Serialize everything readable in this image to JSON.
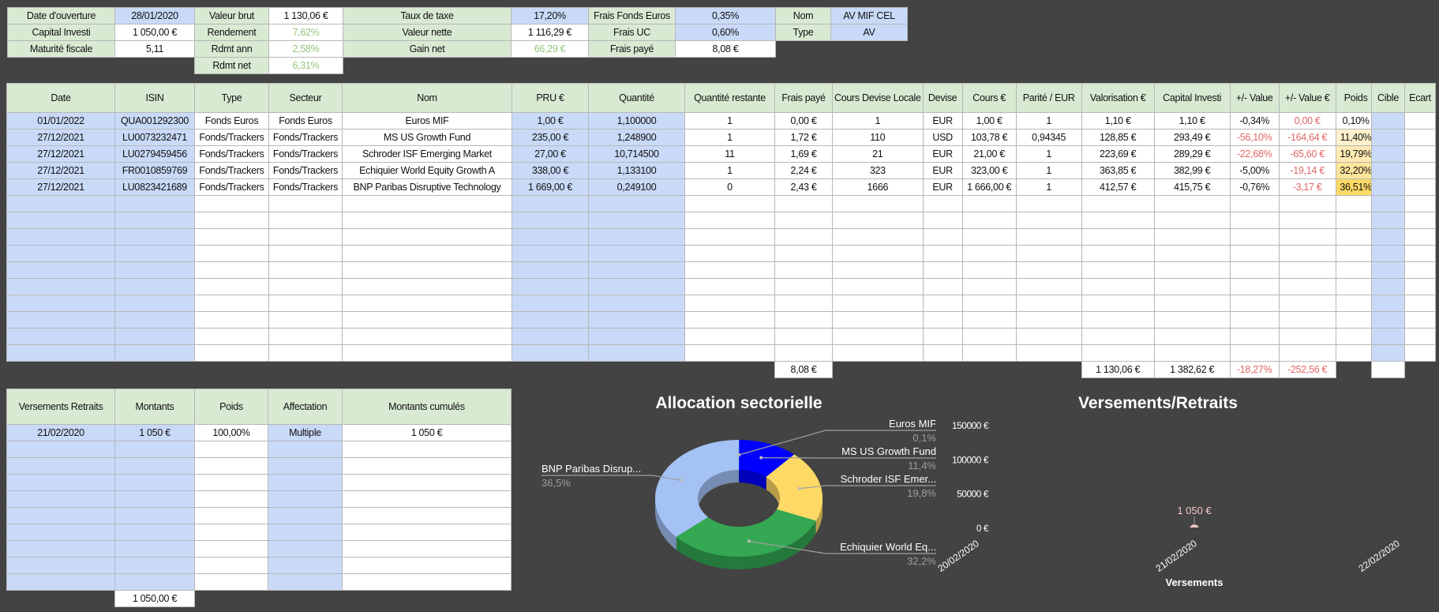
{
  "summary": {
    "rows": [
      [
        {
          "t": "Date d'ouverture",
          "s": "g"
        },
        {
          "t": "28/01/2020",
          "s": "b"
        },
        {
          "t": "Valeur brut",
          "s": "g"
        },
        {
          "t": "1 130,06 €",
          "s": "w"
        },
        {
          "t": "Taux de taxe",
          "s": "g"
        },
        {
          "t": "17,20%",
          "s": "b"
        },
        {
          "t": "Frais Fonds Euros",
          "s": "g"
        },
        {
          "t": "0,35%",
          "s": "b"
        },
        {
          "t": "Nom",
          "s": "g"
        },
        {
          "t": "AV MIF CEL",
          "s": "b"
        }
      ],
      [
        {
          "t": "Capital Investi",
          "s": "g"
        },
        {
          "t": "1 050,00 €",
          "s": "w"
        },
        {
          "t": "Rendement",
          "s": "g"
        },
        {
          "t": "7,62%",
          "s": "w",
          "tc": "green"
        },
        {
          "t": "Valeur nette",
          "s": "g"
        },
        {
          "t": "1 116,29 €",
          "s": "w"
        },
        {
          "t": "Frais UC",
          "s": "g"
        },
        {
          "t": "0,60%",
          "s": "b"
        },
        {
          "t": "Type",
          "s": "g"
        },
        {
          "t": "AV",
          "s": "b"
        }
      ],
      [
        {
          "t": "Maturité fiscale",
          "s": "g"
        },
        {
          "t": "5,11",
          "s": "w"
        },
        {
          "t": "Rdmt ann",
          "s": "g"
        },
        {
          "t": "2,58%",
          "s": "w",
          "tc": "green"
        },
        {
          "t": "Gain net",
          "s": "g"
        },
        {
          "t": "66,29 €",
          "s": "w",
          "tc": "green"
        },
        {
          "t": "Frais payé",
          "s": "g"
        },
        {
          "t": "8,08 €",
          "s": "w"
        },
        {
          "t": "",
          "s": "none"
        },
        {
          "t": "",
          "s": "none"
        }
      ],
      [
        {
          "t": "",
          "s": "none"
        },
        {
          "t": "",
          "s": "none"
        },
        {
          "t": "Rdmt net",
          "s": "g"
        },
        {
          "t": "6,31%",
          "s": "w",
          "tc": "green"
        },
        {
          "t": "",
          "s": "none"
        },
        {
          "t": "",
          "s": "none"
        },
        {
          "t": "",
          "s": "none"
        },
        {
          "t": "",
          "s": "none"
        },
        {
          "t": "",
          "s": "none"
        },
        {
          "t": "",
          "s": "none"
        }
      ]
    ]
  },
  "positions": {
    "headers": [
      "Date",
      "ISIN",
      "Type",
      "Secteur",
      "Nom",
      "PRU €",
      "Quantité",
      "Quantité restante",
      "Frais payé",
      "Cours Devise Locale",
      "Devise",
      "Cours €",
      "Parité / EUR",
      "Valorisation €",
      "Capital Investi",
      "+/- Value",
      "+/- Value €",
      "Poids"
    ],
    "rows": [
      {
        "cells": [
          "01/01/2022",
          "QUA001292300",
          "Fonds Euros",
          "Fonds Euros",
          "Euros MIF",
          "1,00 €",
          "1,100000",
          "1",
          "0,00 €",
          "1",
          "EUR",
          "1,00 €",
          "1",
          "1,10 €",
          "1,10 €",
          "-0,34%",
          "0,00 €",
          "0,10%"
        ],
        "red": [
          16
        ],
        "poids_level": 0
      },
      {
        "cells": [
          "27/12/2021",
          "LU0073232471",
          "Fonds/Trackers",
          "Fonds/Trackers",
          "MS US Growth Fund",
          "235,00 €",
          "1,248900",
          "1",
          "1,72 €",
          "110",
          "USD",
          "103,78 €",
          "0,94345",
          "128,85 €",
          "293,49 €",
          "-56,10%",
          "-164,64 €",
          "11,40%"
        ],
        "red": [
          15,
          16
        ],
        "poids_level": 1
      },
      {
        "cells": [
          "27/12/2021",
          "LU0279459456",
          "Fonds/Trackers",
          "Fonds/Trackers",
          "Schroder ISF Emerging Market",
          "27,00 €",
          "10,714500",
          "11",
          "1,69 €",
          "21",
          "EUR",
          "21,00 €",
          "1",
          "223,69 €",
          "289,29 €",
          "-22,68%",
          "-65,60 €",
          "19,79%"
        ],
        "red": [
          15,
          16
        ],
        "poids_level": 2
      },
      {
        "cells": [
          "27/12/2021",
          "FR0010859769",
          "Fonds/Trackers",
          "Fonds/Trackers",
          "Echiquier World Equity Growth A",
          "338,00 €",
          "1,133100",
          "1",
          "2,24 €",
          "323",
          "EUR",
          "323,00 €",
          "1",
          "363,85 €",
          "382,99 €",
          "-5,00%",
          "-19,14 €",
          "32,20%"
        ],
        "red": [
          16
        ],
        "poids_level": 3
      },
      {
        "cells": [
          "27/12/2021",
          "LU0823421689",
          "Fonds/Trackers",
          "Fonds/Trackers",
          "BNP Paribas Disruptive Technology",
          "1 669,00 €",
          "0,249100",
          "0",
          "2,43 €",
          "1666",
          "EUR",
          "1 666,00 €",
          "1",
          "412,57 €",
          "415,75 €",
          "-0,76%",
          "-3,17 €",
          "36,51%"
        ],
        "red": [
          16
        ],
        "poids_level": 4
      }
    ],
    "empty_rows": 10,
    "totals": {
      "frais": "8,08 €",
      "valorisation": "1 130,06 €",
      "capital": "1 382,62 €",
      "value_pct": "-18,27%",
      "value_eur": "-252,56 €"
    }
  },
  "targets": {
    "headers": [
      "Cible",
      "Ecart"
    ]
  },
  "versements": {
    "headers": [
      "Versements Retraits",
      "Montants",
      "Poids",
      "Affectation",
      "Montants cumulés"
    ],
    "rows": [
      [
        "21/02/2020",
        "1 050 €",
        "100,00%",
        "Multiple",
        "1 050 €"
      ]
    ],
    "empty_rows": 9,
    "total": "1 050,00 €"
  },
  "chart_data": [
    {
      "type": "pie",
      "title": "Allocation sectorielle",
      "labels": [
        "Euros MIF",
        "MS US Growth Fund",
        "Schroder ISF Emer...",
        "Echiquier World Eq...",
        "BNP Paribas Disrup..."
      ],
      "values": [
        0.1,
        11.4,
        19.8,
        32.2,
        36.5
      ],
      "value_labels": [
        "0,1%",
        "11,4%",
        "19,8%",
        "32,2%",
        "36,5%"
      ],
      "colors": [
        "#3c78d8",
        "#0000ff",
        "#ffd966",
        "#34a853",
        "#a4c2f4"
      ]
    },
    {
      "type": "line",
      "title": "Versements/Retraits",
      "categories": [
        "20/02/2020",
        "21/02/2020",
        "22/02/2020"
      ],
      "series": [
        {
          "name": "Versements",
          "values": [
            null,
            1050,
            null
          ],
          "color": "#f4c7c3"
        }
      ],
      "data_labels": [
        "",
        "1 050 €",
        ""
      ],
      "ylim": [
        0,
        150000
      ],
      "yticks": [
        0,
        50000,
        100000,
        150000
      ],
      "ytick_labels": [
        "0 €",
        "50000 €",
        "100000 €",
        "150000 €"
      ],
      "xlabel": "Versements"
    }
  ]
}
